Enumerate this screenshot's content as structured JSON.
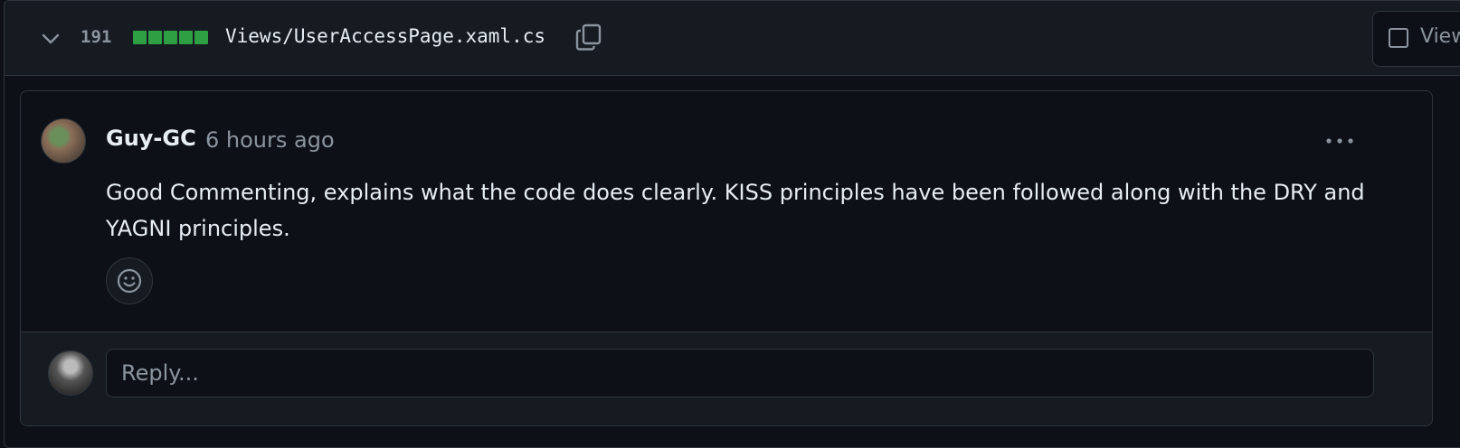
{
  "file": {
    "change_count": "191",
    "filename": "Views/UserAccessPage.xaml.cs",
    "viewed_label": "Viewed",
    "diff_blocks": 5,
    "colors": {
      "added": "#2ea043"
    }
  },
  "comment": {
    "author": "Guy-GC",
    "time": "6 hours ago",
    "body": "Good Commenting, explains what the code does clearly. KISS principles have been followed along with the DRY and YAGNI principles."
  },
  "reply": {
    "placeholder": "Reply..."
  },
  "icons": [
    "chevron-down-icon",
    "copy-icon",
    "kebab-icon",
    "smiley-icon"
  ]
}
